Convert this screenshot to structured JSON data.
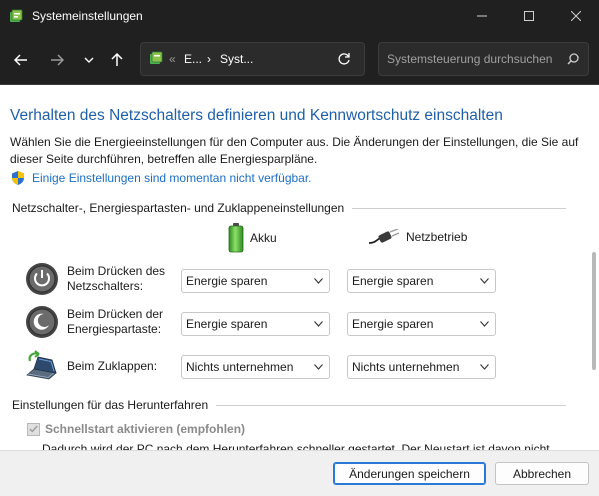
{
  "window": {
    "title": "Systemeinstellungen",
    "icons": {
      "minimize": "minimize-icon",
      "maximize": "maximize-icon",
      "close": "close-icon"
    }
  },
  "nav": {
    "breadcrumb": [
      "E...",
      "Syst..."
    ],
    "breadcrumb_prefix": "«",
    "search_placeholder": "Systemsteuerung durchsuchen"
  },
  "main": {
    "heading": "Verhalten des Netzschalters definieren und Kennwortschutz einschalten",
    "description": "Wählen Sie die Energieeinstellungen für den Computer aus. Die Änderungen der Einstellungen, die Sie auf dieser Seite durchführen, betreffen alle Energiesparpläne.",
    "unavailable_link": "Einige Einstellungen sind momentan nicht verfügbar.",
    "buttons_section": "Netzschalter-, Energiespartasten- und Zuklappeneinstellungen",
    "col_battery": "Akku",
    "col_power": "Netzbetrieb",
    "rows": [
      {
        "label": "Beim Drücken des Netzschalters:",
        "icon": "power-button-icon",
        "ac": "Energie sparen",
        "dc": "Energie sparen"
      },
      {
        "label": "Beim Drücken der Energiespartaste:",
        "icon": "sleep-button-icon",
        "ac": "Energie sparen",
        "dc": "Energie sparen"
      },
      {
        "label": "Beim Zuklappen:",
        "icon": "laptop-lid-icon",
        "ac": "Nichts unternehmen",
        "dc": "Nichts unternehmen"
      }
    ],
    "shutdown_section": "Einstellungen für das Herunterfahren",
    "fast_startup_label": "Schnellstart aktivieren (empfohlen)",
    "fast_startup_checked": true,
    "fast_startup_desc": "Dadurch wird der PC nach dem Herunterfahren schneller gestartet. Der Neustart ist davon nicht"
  },
  "footer": {
    "save_label": "Änderungen speichern",
    "cancel_label": "Abbrechen"
  },
  "colors": {
    "titlebar": "#202020",
    "heading": "#1f5fa8",
    "link": "#1c6fc2",
    "accent": "#2b79d6"
  }
}
